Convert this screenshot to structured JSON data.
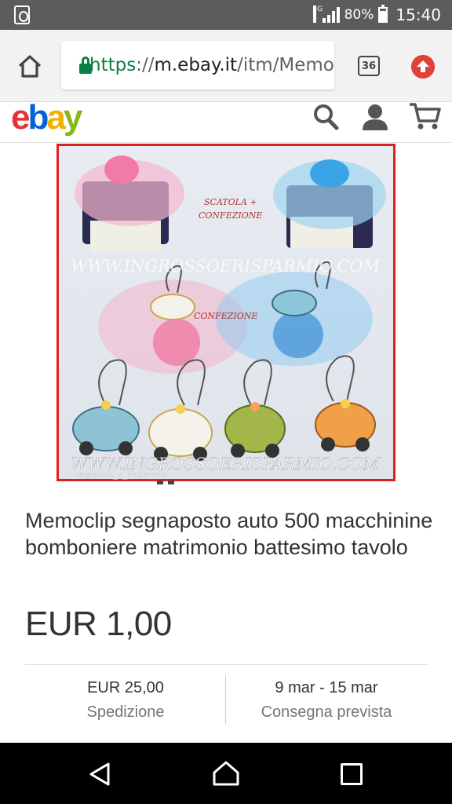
{
  "status_bar": {
    "network": "4G",
    "battery_percent": "80%",
    "battery_level": 0.8,
    "time": "15:40"
  },
  "browser": {
    "url_scheme": "https",
    "url_sep": "://",
    "url_host": "m.ebay.it",
    "url_path": "/itm/Memoclip",
    "tab_count": "36"
  },
  "header": {
    "logo_letters": [
      "e",
      "b",
      "a",
      "y"
    ],
    "icons": [
      "search-icon",
      "user-icon",
      "cart-icon"
    ]
  },
  "product": {
    "image_text": {
      "scatola": "SCATOLA +",
      "confezione_top": "CONFEZIONE",
      "confezione_mid": "CONFEZIONE",
      "watermark_top": "WWW.INGROSSOERISPARMIO.COM",
      "watermark_bottom": "WWW.INGROSSOERISPARMIO.COM",
      "credit": "ingrosso_e_risparmio"
    },
    "title": "Memoclip segnaposto auto 500 macchinine bomboniere matrimonio battesimo tavolo",
    "price": "EUR 1,00",
    "shipping_value": "EUR 25,00",
    "shipping_label": "Spedizione",
    "delivery_value": "9 mar - 15 mar",
    "delivery_label": "Consegna prevista"
  },
  "colors": {
    "ebay_red": "#e53238",
    "ebay_blue": "#0064d2",
    "ebay_yellow": "#f5af02",
    "ebay_green": "#86b817",
    "secure_green": "#0b8043",
    "image_border": "#e02020"
  }
}
